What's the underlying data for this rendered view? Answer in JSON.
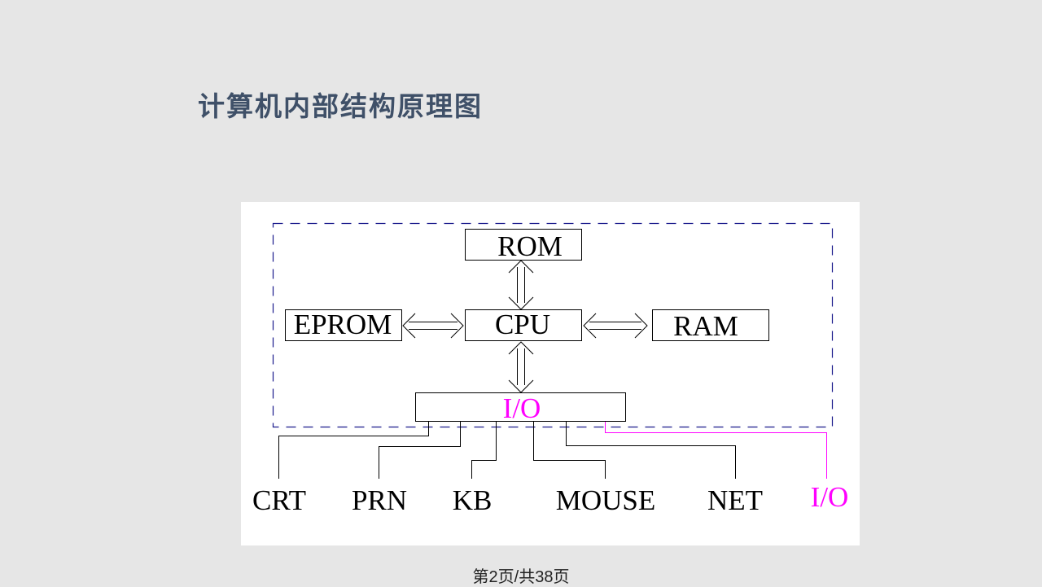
{
  "slide": {
    "title": "计算机内部结构原理图",
    "footer": "第2页/共38页"
  },
  "diagram": {
    "colors": {
      "frame": "#1a1a8c",
      "box": "#000000",
      "io": "#ff00ff",
      "text": "#000000",
      "title": "#3f5068"
    },
    "boxes": {
      "rom": "ROM",
      "cpu": "CPU",
      "eprom": "EPROM",
      "ram": "RAM",
      "io": "I/O"
    },
    "devices": [
      {
        "id": "crt",
        "label": "CRT"
      },
      {
        "id": "prn",
        "label": "PRN"
      },
      {
        "id": "kb",
        "label": "KB"
      },
      {
        "id": "mouse",
        "label": "MOUSE"
      },
      {
        "id": "net",
        "label": "NET"
      },
      {
        "id": "io-ext",
        "label": "I/O"
      }
    ],
    "connections": [
      {
        "from": "ROM",
        "to": "CPU",
        "type": "bidirectional"
      },
      {
        "from": "EPROM",
        "to": "CPU",
        "type": "bidirectional"
      },
      {
        "from": "CPU",
        "to": "RAM",
        "type": "bidirectional"
      },
      {
        "from": "CPU",
        "to": "I/O",
        "type": "bidirectional"
      },
      {
        "from": "I/O",
        "to": "CRT",
        "type": "line"
      },
      {
        "from": "I/O",
        "to": "PRN",
        "type": "line"
      },
      {
        "from": "I/O",
        "to": "KB",
        "type": "line"
      },
      {
        "from": "I/O",
        "to": "MOUSE",
        "type": "line"
      },
      {
        "from": "I/O",
        "to": "NET",
        "type": "line"
      },
      {
        "from": "I/O",
        "to": "I/O (external)",
        "type": "line"
      }
    ]
  }
}
